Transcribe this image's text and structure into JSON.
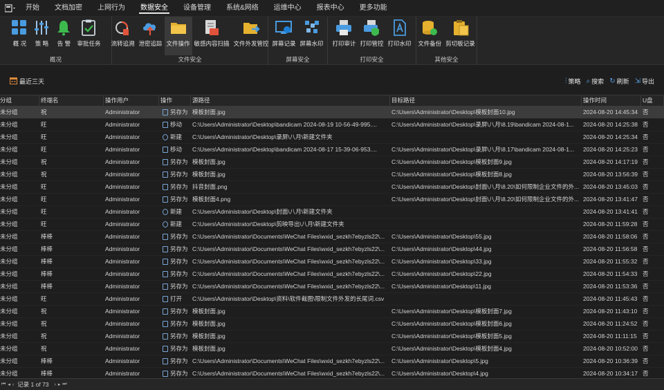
{
  "menu": {
    "app_icon": "app-menu-icon",
    "items": [
      "开始",
      "文档加密",
      "上网行为",
      "数据安全",
      "设备管理",
      "系统&网络",
      "运维中心",
      "报表中心",
      "更多功能"
    ],
    "active_index": 3
  },
  "ribbon": {
    "groups": [
      {
        "label": "概况",
        "buttons": [
          {
            "label": "概 况",
            "icon": "overview-grid-icon"
          },
          {
            "label": "策 略",
            "icon": "policy-sliders-icon"
          },
          {
            "label": "告 警",
            "icon": "alarm-bell-icon"
          },
          {
            "label": "审批任务",
            "icon": "approval-task-icon"
          }
        ]
      },
      {
        "label": "文件安全",
        "buttons": [
          {
            "label": "流转追溯",
            "icon": "flow-trace-icon"
          },
          {
            "label": "泄密追踪",
            "icon": "leak-cloud-icon"
          },
          {
            "label": "文件操作",
            "icon": "file-operation-folder-icon",
            "active": true
          },
          {
            "label": "敏感内容扫描",
            "icon": "sensitive-scan-icon"
          },
          {
            "label": "文件外发管控",
            "icon": "file-outgoing-icon"
          }
        ]
      },
      {
        "label": "屏幕安全",
        "buttons": [
          {
            "label": "屏幕记录",
            "icon": "screen-record-icon"
          },
          {
            "label": "屏幕水印",
            "icon": "screen-watermark-icon"
          }
        ]
      },
      {
        "label": "打印安全",
        "buttons": [
          {
            "label": "打印审计",
            "icon": "print-audit-icon"
          },
          {
            "label": "打印管控",
            "icon": "print-control-icon"
          },
          {
            "label": "打印水印",
            "icon": "print-watermark-icon"
          }
        ]
      },
      {
        "label": "其他安全",
        "buttons": [
          {
            "label": "文件备份",
            "icon": "file-backup-icon"
          },
          {
            "label": "剪切板记录",
            "icon": "clipboard-record-icon"
          }
        ]
      }
    ]
  },
  "filter": {
    "range_label": "最近三天",
    "tools": [
      {
        "label": "策略",
        "icon": "policy-icon"
      },
      {
        "label": "搜索",
        "icon": "search-icon"
      },
      {
        "label": "刷新",
        "icon": "refresh-icon"
      },
      {
        "label": "导出",
        "icon": "export-icon"
      }
    ]
  },
  "table": {
    "columns": [
      "分组",
      "终端名",
      "操作用户",
      "操作",
      "源路径",
      "目标路径",
      "操作时间",
      "U盘"
    ],
    "rows": [
      [
        "未分组",
        "祝",
        "Administrator",
        "另存为",
        "模板封面.jpg",
        "C:\\Users\\Administrator\\Desktop\\模板封面10.jpg",
        "2024-08-20 14:45:34",
        "否"
      ],
      [
        "未分组",
        "旺",
        "Administrator",
        "移动",
        "C:\\Users\\Administrator\\Desktop\\bandicam 2024-08-19 10-56-49-995....",
        "C:\\Users\\Administrator\\Desktop\\录屏\\八月\\8.19\\bandicam 2024-08-1...",
        "2024-08-20 14:25:38",
        "否"
      ],
      [
        "未分组",
        "旺",
        "Administrator",
        "新建",
        "C:\\Users\\Administrator\\Desktop\\录屏\\八月\\新建文件夹",
        "",
        "2024-08-20 14:25:34",
        "否"
      ],
      [
        "未分组",
        "旺",
        "Administrator",
        "移动",
        "C:\\Users\\Administrator\\Desktop\\bandicam 2024-08-17 15-39-06-953....",
        "C:\\Users\\Administrator\\Desktop\\录屏\\八月\\8.17\\bandicam 2024-08-1...",
        "2024-08-20 14:25:23",
        "否"
      ],
      [
        "未分组",
        "祝",
        "Administrator",
        "另存为",
        "模板封面.jpg",
        "C:\\Users\\Administrator\\Desktop\\模板封面9.jpg",
        "2024-08-20 14:17:19",
        "否"
      ],
      [
        "未分组",
        "祝",
        "Administrator",
        "另存为",
        "模板封面.jpg",
        "C:\\Users\\Administrator\\Desktop\\模板封面8.jpg",
        "2024-08-20 13:56:39",
        "否"
      ],
      [
        "未分组",
        "旺",
        "Administrator",
        "另存为",
        "抖音封面.png",
        "C:\\Users\\Administrator\\Desktop\\封面\\八月\\8.20\\如何限制企业文件的外...",
        "2024-08-20 13:45:03",
        "否"
      ],
      [
        "未分组",
        "旺",
        "Administrator",
        "另存为",
        "模板封面4.png",
        "C:\\Users\\Administrator\\Desktop\\封面\\八月\\8.20\\如何限制企业文件的外...",
        "2024-08-20 13:41:47",
        "否"
      ],
      [
        "未分组",
        "旺",
        "Administrator",
        "新建",
        "C:\\Users\\Administrator\\Desktop\\封面\\八月\\新建文件夹",
        "",
        "2024-08-20 13:41:41",
        "否"
      ],
      [
        "未分组",
        "旺",
        "Administrator",
        "新建",
        "C:\\Users\\Administrator\\Desktop\\剪映导出\\八月\\新建文件夹",
        "",
        "2024-08-20 11:59:28",
        "否"
      ],
      [
        "未分组",
        "棒棒",
        "Administrator",
        "另存为",
        "C:\\Users\\Administrator\\Documents\\WeChat Files\\wxid_sezkh7ebyzls22\\...",
        "C:\\Users\\Administrator\\Desktop\\55.jpg",
        "2024-08-20 11:58:06",
        "否"
      ],
      [
        "未分组",
        "棒棒",
        "Administrator",
        "另存为",
        "C:\\Users\\Administrator\\Documents\\WeChat Files\\wxid_sezkh7ebyzls22\\...",
        "C:\\Users\\Administrator\\Desktop\\44.jpg",
        "2024-08-20 11:56:58",
        "否"
      ],
      [
        "未分组",
        "棒棒",
        "Administrator",
        "另存为",
        "C:\\Users\\Administrator\\Documents\\WeChat Files\\wxid_sezkh7ebyzls22\\...",
        "C:\\Users\\Administrator\\Desktop\\33.jpg",
        "2024-08-20 11:55:32",
        "否"
      ],
      [
        "未分组",
        "棒棒",
        "Administrator",
        "另存为",
        "C:\\Users\\Administrator\\Documents\\WeChat Files\\wxid_sezkh7ebyzls22\\...",
        "C:\\Users\\Administrator\\Desktop\\22.jpg",
        "2024-08-20 11:54:33",
        "否"
      ],
      [
        "未分组",
        "棒棒",
        "Administrator",
        "另存为",
        "C:\\Users\\Administrator\\Documents\\WeChat Files\\wxid_sezkh7ebyzls22\\...",
        "C:\\Users\\Administrator\\Desktop\\11.jpg",
        "2024-08-20 11:53:36",
        "否"
      ],
      [
        "未分组",
        "旺",
        "Administrator",
        "打开",
        "C:\\Users\\Administrator\\Desktop\\资料\\软件截图\\限制文件外发的长尾词.csv",
        "",
        "2024-08-20 11:45:43",
        "否"
      ],
      [
        "未分组",
        "祝",
        "Administrator",
        "另存为",
        "模板封面.jpg",
        "C:\\Users\\Administrator\\Desktop\\模板封面7.jpg",
        "2024-08-20 11:43:10",
        "否"
      ],
      [
        "未分组",
        "祝",
        "Administrator",
        "另存为",
        "模板封面.jpg",
        "C:\\Users\\Administrator\\Desktop\\模板封面6.jpg",
        "2024-08-20 11:24:52",
        "否"
      ],
      [
        "未分组",
        "祝",
        "Administrator",
        "另存为",
        "模板封面.jpg",
        "C:\\Users\\Administrator\\Desktop\\模板封面5.jpg",
        "2024-08-20 11:11:15",
        "否"
      ],
      [
        "未分组",
        "祝",
        "Administrator",
        "另存为",
        "模板封面.jpg",
        "C:\\Users\\Administrator\\Desktop\\模板封面4.jpg",
        "2024-08-20 10:52:00",
        "否"
      ],
      [
        "未分组",
        "棒棒",
        "Administrator",
        "另存为",
        "C:\\Users\\Administrator\\Documents\\WeChat Files\\wxid_sezkh7ebyzls22\\...",
        "C:\\Users\\Administrator\\Desktop\\5.jpg",
        "2024-08-20 10:36:39",
        "否"
      ],
      [
        "未分组",
        "棒棒",
        "Administrator",
        "另存为",
        "C:\\Users\\Administrator\\Documents\\WeChat Files\\wxid_sezkh7ebyzls22\\...",
        "C:\\Users\\Administrator\\Desktop\\4.jpg",
        "2024-08-20 10:34:17",
        "否"
      ]
    ],
    "selected_row": 0
  },
  "footer": {
    "record_text": "记录 1 of 73"
  },
  "colors": {
    "accent_blue": "#4a9be0",
    "bell_green": "#3dba4e",
    "folder_yellow": "#e6b12e",
    "selected_row": "#3c3c3c"
  }
}
